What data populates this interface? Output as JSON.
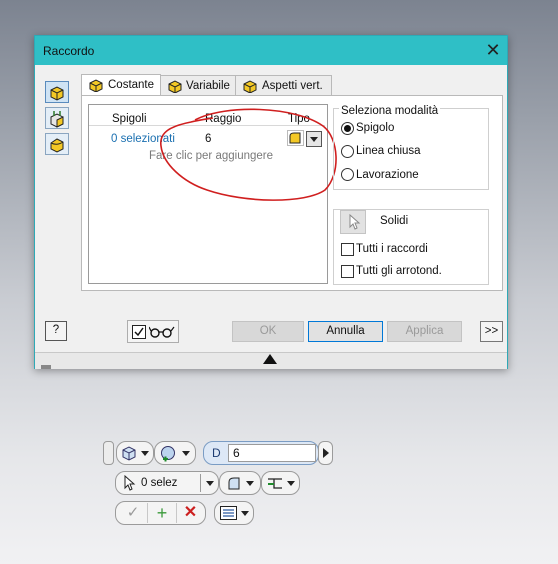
{
  "dialog": {
    "title": "Raccordo",
    "close_glyph": "✕",
    "tabs": [
      {
        "label": "Costante",
        "icon": "constant-fillet-icon",
        "active": true
      },
      {
        "label": "Variabile",
        "icon": "variable-fillet-icon",
        "active": false
      },
      {
        "label": "Aspetti vert.",
        "icon": "vertex-setback-icon",
        "active": false
      }
    ],
    "left_tools": [
      "edge-fillet-icon",
      "face-fillet-icon",
      "full-round-fillet-icon"
    ],
    "table": {
      "col_edges": "Spigoli",
      "col_radius": "Raggio",
      "col_type": "Tipo",
      "row_edges": "0 selezionati",
      "row_radius": "6",
      "hint": "Fare clic per aggiungere"
    },
    "selection_mode": {
      "title": "Seleziona modalità",
      "options": [
        "Spigolo",
        "Linea chiusa",
        "Lavorazione"
      ],
      "selected": "Spigolo"
    },
    "solids_label": "Solidi",
    "all_fillets": "Tutti i raccordi",
    "all_rounds": "Tutti gli arrotond.",
    "buttons": {
      "help": "?",
      "ok": "OK",
      "cancel": "Annulla",
      "apply": "Applica",
      "more": ">>"
    },
    "accent_color": "#2fbfc6",
    "annotation_color": "#d01f1f"
  },
  "minitoolbar": {
    "dim_label": "D",
    "dim_value": "6",
    "selection_count": "0 selez"
  }
}
